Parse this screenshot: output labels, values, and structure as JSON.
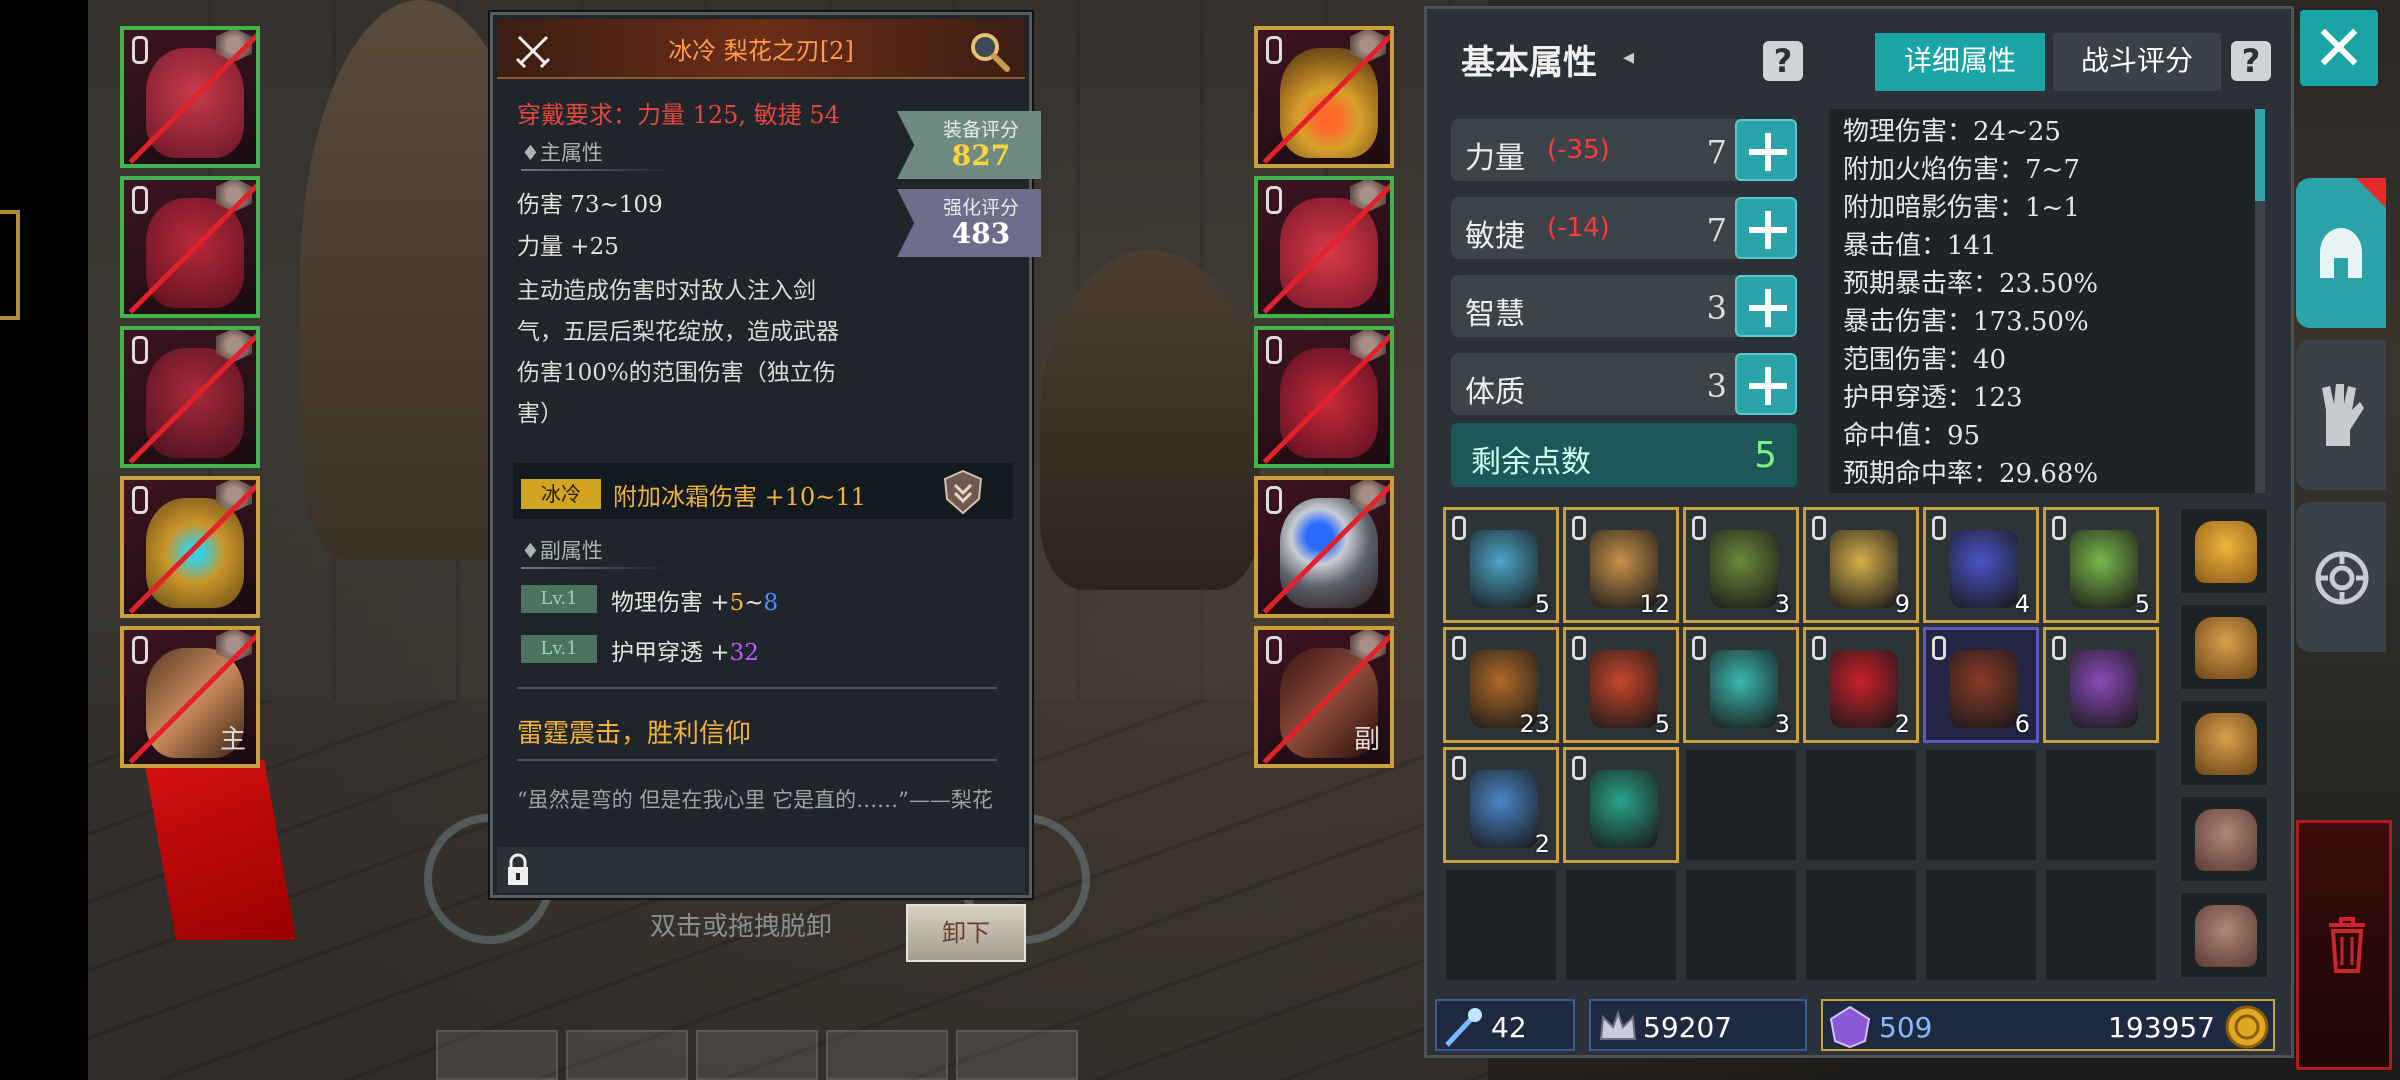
{
  "item": {
    "title": "冰冷 梨花之刃[2]",
    "requirement": "穿戴要求：力量 125, 敏捷 54",
    "equip_score_label": "装备评分",
    "equip_score": "827",
    "enhance_score_label": "强化评分",
    "enhance_score": "483",
    "main_attr_label": "♦主属性",
    "damage": "伤害  73~109",
    "strength": "力量 +25",
    "description": "主动造成伤害时对敌人注入剑气，五层后梨花绽放，造成武器伤害100%的范围伤害（独立伤害）",
    "affix_tag": "冰冷",
    "affix_text": "附加冰霜伤害 +10~11",
    "sub_attr_label": "♦副属性",
    "sub_attrs": [
      {
        "level": "Lv.1",
        "name": "物理伤害 +",
        "base": "5",
        "sep": "~",
        "extra": "8"
      },
      {
        "level": "Lv.1",
        "name": "护甲穿透 +",
        "base": "",
        "sep": "",
        "extra": "32"
      }
    ],
    "set_name": "雷霆震击，胜利信仰",
    "quote": "“虽然是弯的  但是在我心里  它是直的……”——梨花"
  },
  "actions": {
    "hint": "双击或拖拽脱卸",
    "unequip": "卸下"
  },
  "left_slots": [
    {
      "icon": "helmet-icon",
      "mark": ""
    },
    {
      "icon": "chest-armor-icon",
      "mark": ""
    },
    {
      "icon": "leg-armor-icon",
      "mark": ""
    },
    {
      "icon": "amulet-ring-icon",
      "mark": ""
    },
    {
      "icon": "main-weapon-icon",
      "mark": "主"
    }
  ],
  "right_slots": [
    {
      "icon": "necklace-icon",
      "mark": ""
    },
    {
      "icon": "gloves-icon",
      "mark": ""
    },
    {
      "icon": "boots-icon",
      "mark": ""
    },
    {
      "icon": "ring-icon",
      "mark": ""
    },
    {
      "icon": "offhand-weapon-icon",
      "mark": "副"
    }
  ],
  "stats": {
    "title": "基本属性",
    "title_arrow": "◂",
    "tabs": [
      "详细属性",
      "战斗评分"
    ],
    "rows": [
      {
        "name": "力量",
        "delta": "(-35)",
        "value": "7"
      },
      {
        "name": "敏捷",
        "delta": "(-14)",
        "value": "7"
      },
      {
        "name": "智慧",
        "delta": "",
        "value": "3"
      },
      {
        "name": "体质",
        "delta": "",
        "value": "3"
      }
    ],
    "remaining_label": "剩余点数",
    "remaining_value": "5",
    "details": [
      "物理伤害：24~25",
      "附加火焰伤害：7~7",
      "附加暗影伤害：1~1",
      "暴击值：141",
      "预期暴击率：23.50%",
      "暴击伤害：173.50%",
      "范围伤害：40",
      "护甲穿透：123",
      "命中值：95",
      "预期命中率：29.68%"
    ]
  },
  "inventory": [
    {
      "icon": "rune-scroll-icon",
      "count": "5",
      "color": "#4aa6c8"
    },
    {
      "icon": "scroll-icon",
      "count": "12",
      "color": "#c9914a"
    },
    {
      "icon": "turtle-shell-icon",
      "count": "3",
      "color": "#6b8a3a"
    },
    {
      "icon": "yellow-scroll-icon",
      "count": "9",
      "color": "#d6b04a"
    },
    {
      "icon": "blue-firework-icon",
      "count": "4",
      "color": "#4a54c8"
    },
    {
      "icon": "green-firework-icon",
      "count": "5",
      "color": "#7ab84a"
    },
    {
      "icon": "spiral-shell-icon",
      "count": "23",
      "color": "#b06a28"
    },
    {
      "icon": "red-crystal-icon",
      "count": "5",
      "color": "#c8462a"
    },
    {
      "icon": "cyan-potion-icon",
      "count": "3",
      "color": "#3ab8b0"
    },
    {
      "icon": "red-envelope-icon",
      "count": "2",
      "color": "#c8202a"
    },
    {
      "icon": "card-icon",
      "count": "6",
      "color": "#8a3a28"
    },
    {
      "icon": "purple-drill-icon",
      "count": "",
      "color": "#8a4ab8"
    },
    {
      "icon": "ice-drill-icon",
      "count": "2",
      "color": "#4a86c8"
    },
    {
      "icon": "gift-box-icon",
      "count": "",
      "color": "#2aa48a"
    }
  ],
  "bags": [
    "treasure-bag-icon",
    "bag-icon",
    "bag-icon",
    "bag-icon",
    "bag-icon"
  ],
  "currency": {
    "enhance_stones": "42",
    "silver": "59207",
    "gems": "509",
    "gold": "193957"
  },
  "colors": {
    "accent": "#1aa4a6",
    "gold_border": "#c9a03c",
    "green_border": "#3fb54b",
    "negative": "#ff3a3a"
  }
}
